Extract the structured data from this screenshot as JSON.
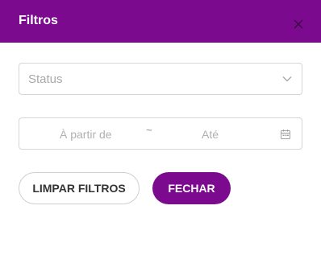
{
  "header": {
    "title": "Filtros",
    "close_icon": "close-icon",
    "background": "#7b0a8f"
  },
  "status_select": {
    "placeholder": "Status",
    "icon": "chevron-down-icon"
  },
  "date_range": {
    "start_placeholder": "À partir de",
    "separator": "~",
    "end_placeholder": "Até",
    "icon": "calendar-icon"
  },
  "actions": {
    "clear_label": "LIMPAR FILTROS",
    "close_label": "FECHAR",
    "accent": "#7b0a8f"
  }
}
